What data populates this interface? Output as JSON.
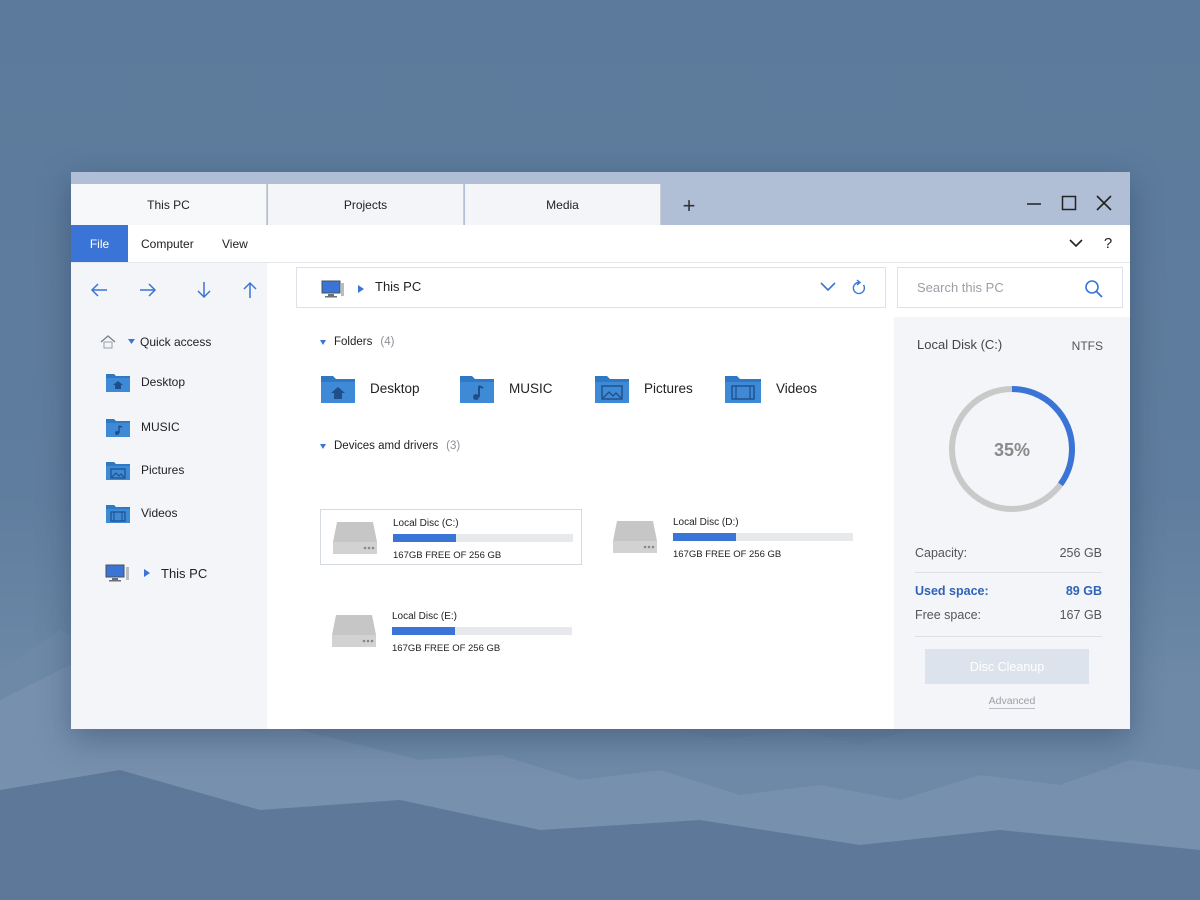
{
  "tabs": [
    {
      "label": "This PC"
    },
    {
      "label": "Projects"
    },
    {
      "label": "Media"
    }
  ],
  "tab_add_label": "+",
  "menu": {
    "file": "File",
    "computer": "Computer",
    "view": "View",
    "help": "?"
  },
  "address": {
    "text": "This PC"
  },
  "search": {
    "placeholder": "Search this PC"
  },
  "sidebar": {
    "quick_access": "Quick access",
    "items": [
      {
        "label": "Desktop",
        "icon": "home-folder-icon"
      },
      {
        "label": "MUSIC",
        "icon": "music-folder-icon"
      },
      {
        "label": "Pictures",
        "icon": "pictures-folder-icon"
      },
      {
        "label": "Videos",
        "icon": "videos-folder-icon"
      }
    ],
    "this_pc": "This PC"
  },
  "main": {
    "folders_heading": "Folders",
    "folders_count": "(4)",
    "folders": [
      {
        "label": "Desktop"
      },
      {
        "label": "MUSIC"
      },
      {
        "label": "Pictures"
      },
      {
        "label": "Videos"
      }
    ],
    "devices_heading": "Devices amd drivers",
    "devices_count": "(3)",
    "drives": [
      {
        "name": "Local Disc (C:)",
        "free": "167GB FREE OF 256 GB",
        "used_fraction": 0.35
      },
      {
        "name": "Local Disc (D:)",
        "free": "167GB FREE OF 256 GB",
        "used_fraction": 0.35
      },
      {
        "name": "Local Disc (E:)",
        "free": "167GB FREE OF 256 GB",
        "used_fraction": 0.35
      }
    ]
  },
  "details": {
    "title": "Local Disk (C:)",
    "filesystem": "NTFS",
    "percent_label": "35%",
    "used_fraction": 0.35,
    "capacity_label": "Capacity:",
    "capacity_value": "256 GB",
    "used_label": "Used space:",
    "used_value": "89 GB",
    "free_label": "Free space:",
    "free_value": "167 GB",
    "cleanup_button": "Disc Cleanup",
    "advanced_link": "Advanced"
  },
  "colors": {
    "accent": "#3a74d7",
    "folder": "#3a86cf",
    "ring_bg": "#c9c9c9"
  }
}
